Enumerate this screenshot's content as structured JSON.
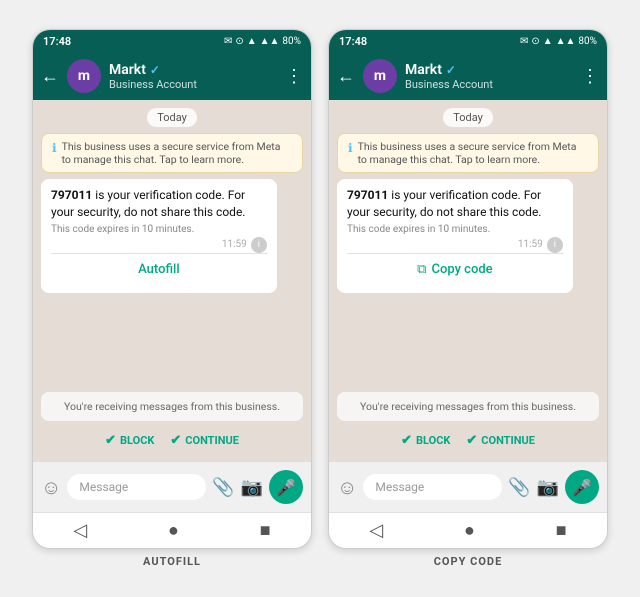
{
  "phones": [
    {
      "id": "autofill",
      "label": "AUTOFILL",
      "statusBar": {
        "time": "17:48",
        "battery": "80%"
      },
      "header": {
        "name": "Markt",
        "subtitle": "Business Account",
        "verified": true
      },
      "chat": {
        "dateBubble": "Today",
        "infoMessage": "This business uses a secure service from Meta to manage this chat. Tap to learn more.",
        "messageStrong": "797011",
        "messageText": " is your verification code. For your security, do not share this code.",
        "messageSubtext": "This code expires in 10 minutes.",
        "messageTime": "11:59",
        "actionLabel": "Autofill",
        "actionType": "autofill"
      },
      "businessNotice": "You're receiving messages from this business.",
      "blockLabel": "BLOCK",
      "continueLabel": "CONTINUE",
      "inputPlaceholder": "Message",
      "navBar": [
        "◁",
        "●",
        "■"
      ]
    },
    {
      "id": "copy-code",
      "label": "COPY CODE",
      "statusBar": {
        "time": "17:48",
        "battery": "80%"
      },
      "header": {
        "name": "Markt",
        "subtitle": "Business Account",
        "verified": true
      },
      "chat": {
        "dateBubble": "Today",
        "infoMessage": "This business uses a secure service from Meta to manage this chat. Tap to learn more.",
        "messageStrong": "797011",
        "messageText": " is your verification code. For your security, do not share this code.",
        "messageSubtext": "This code expires in 10 minutes.",
        "messageTime": "11:59",
        "actionLabel": "Copy code",
        "actionType": "copy"
      },
      "businessNotice": "You're receiving messages from this business.",
      "blockLabel": "BLOCK",
      "continueLabel": "CONTINUE",
      "inputPlaceholder": "Message",
      "navBar": [
        "◁",
        "●",
        "■"
      ]
    }
  ]
}
